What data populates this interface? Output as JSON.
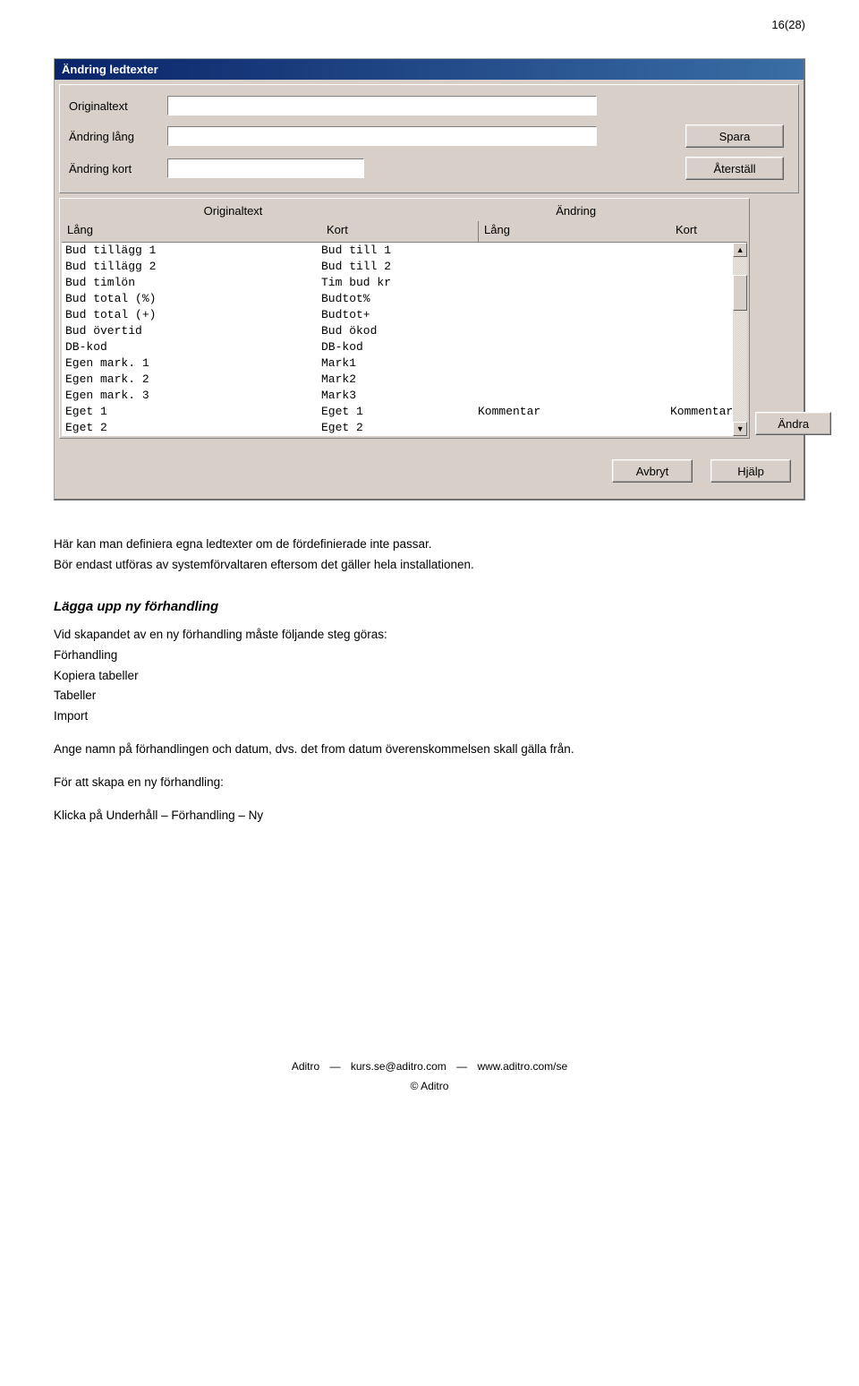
{
  "page_num": "16(28)",
  "dialog": {
    "title": "Ändring ledtexter",
    "fields": {
      "originaltext_label": "Originaltext",
      "andring_lang_label": "Ändring lång",
      "andring_kort_label": "Ändring kort"
    },
    "buttons": {
      "spara": "Spara",
      "aterstall": "Återställ",
      "andra": "Ändra",
      "avbryt": "Avbryt",
      "hjalp": "Hjälp"
    },
    "table_headers": {
      "originaltext": "Originaltext",
      "andring": "Ändring",
      "lang": "Lång",
      "kort": "Kort"
    },
    "rows": [
      {
        "l1": "Bud tillägg 1",
        "k1": "Bud till 1",
        "l2": "",
        "k2": ""
      },
      {
        "l1": "Bud tillägg 2",
        "k1": "Bud till 2",
        "l2": "",
        "k2": ""
      },
      {
        "l1": "Bud timlön",
        "k1": "Tim bud kr",
        "l2": "",
        "k2": ""
      },
      {
        "l1": "Bud total (%)",
        "k1": "Budtot%",
        "l2": "",
        "k2": ""
      },
      {
        "l1": "Bud total (+)",
        "k1": "Budtot+",
        "l2": "",
        "k2": ""
      },
      {
        "l1": "Bud övertid",
        "k1": "Bud ökod",
        "l2": "",
        "k2": ""
      },
      {
        "l1": "DB-kod",
        "k1": "DB-kod",
        "l2": "",
        "k2": ""
      },
      {
        "l1": "Egen mark. 1",
        "k1": "Mark1",
        "l2": "",
        "k2": ""
      },
      {
        "l1": "Egen mark. 2",
        "k1": "Mark2",
        "l2": "",
        "k2": ""
      },
      {
        "l1": "Egen mark. 3",
        "k1": "Mark3",
        "l2": "",
        "k2": ""
      },
      {
        "l1": "Eget 1",
        "k1": "Eget 1",
        "l2": "Kommentar",
        "k2": "Kommentar"
      },
      {
        "l1": "Eget 2",
        "k1": "Eget 2",
        "l2": "",
        "k2": ""
      }
    ]
  },
  "body": {
    "p1": "Här kan man definiera egna ledtexter om de fördefinierade inte passar.",
    "p2": "Bör endast utföras av systemförvaltaren eftersom det gäller hela installationen.",
    "h3": "Lägga upp ny förhandling",
    "p3": "Vid skapandet av en ny förhandling måste följande steg göras:",
    "li1": "Förhandling",
    "li2": "Kopiera tabeller",
    "li3": "Tabeller",
    "li4": "Import",
    "p4": "Ange namn på förhandlingen och datum, dvs. det from datum överenskommelsen skall gälla från.",
    "p5": "För att skapa en ny förhandling:",
    "p6": "Klicka på Underhåll – Förhandling – Ny"
  },
  "footer": {
    "company": "Aditro",
    "email": "kurs.se@aditro.com",
    "url": "www.aditro.com/se",
    "copyright": "© Aditro"
  }
}
